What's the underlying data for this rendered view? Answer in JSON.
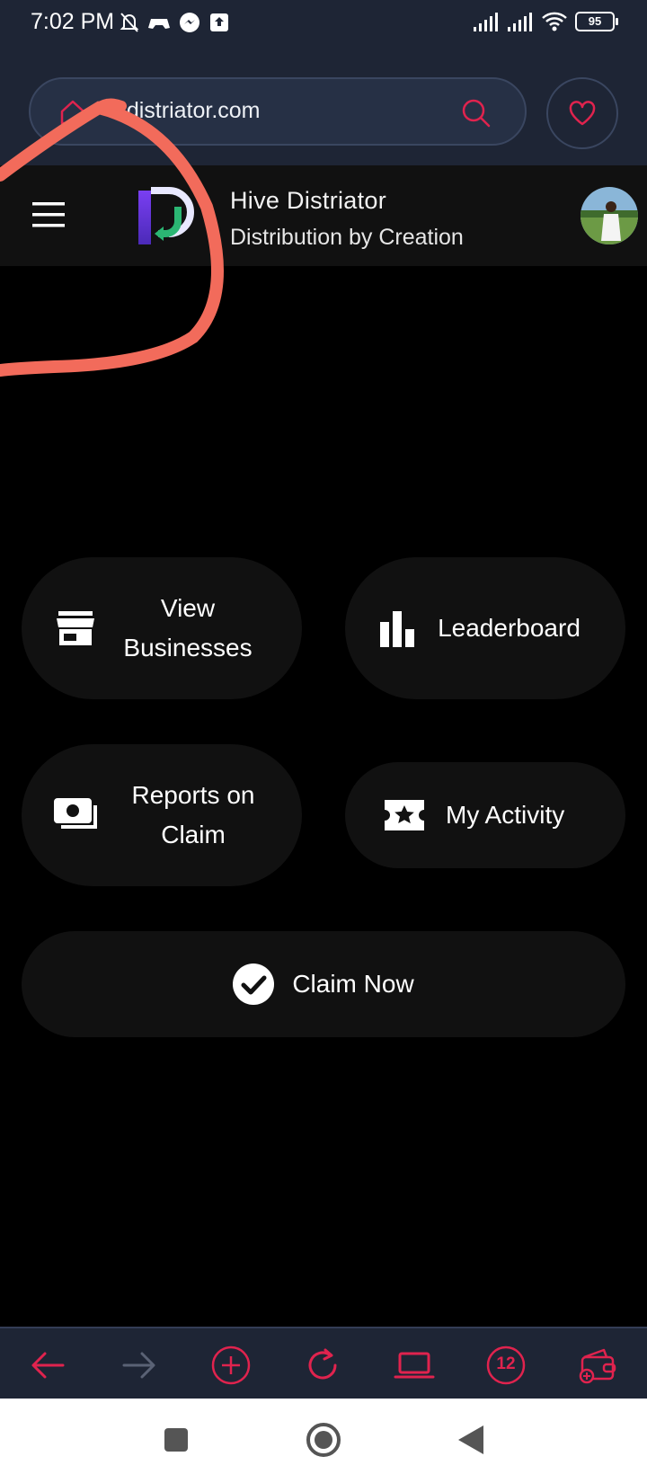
{
  "status_bar": {
    "time": "7:02 PM",
    "battery": "95"
  },
  "browser": {
    "url_display": "...distriator.com"
  },
  "app": {
    "title": "Hive Distriator",
    "subtitle": "Distribution by Creation"
  },
  "tiles": {
    "view_businesses": "View Businesses",
    "leaderboard": "Leaderboard",
    "reports_on_claim": "Reports on Claim",
    "my_activity": "My Activity",
    "claim_now": "Claim Now"
  },
  "bottom_nav": {
    "tabs_count": "12"
  },
  "colors": {
    "accent": "#e0234e",
    "browser_bg": "#1e2535",
    "tile_bg": "#111111",
    "annotation": "#f26b5b"
  }
}
